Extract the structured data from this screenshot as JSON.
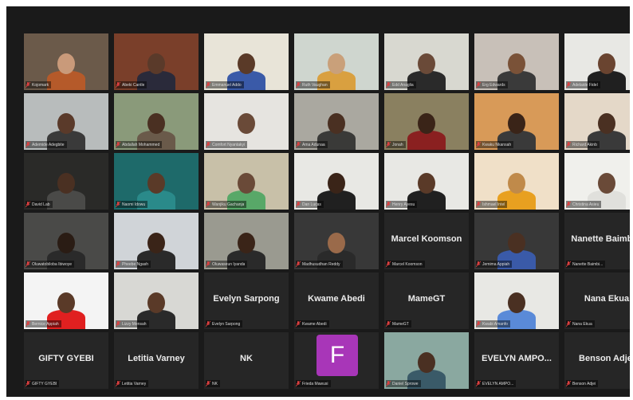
{
  "window": {
    "background": "#1a1a1a",
    "active_speaker_color": "#c7d94a"
  },
  "tiles": [
    {
      "kind": "video",
      "label": "Kojomark",
      "bg": "#6b5a4a",
      "skin": "#c99a7a",
      "shirt": "#b55a2a"
    },
    {
      "kind": "video",
      "label": "Abeki Cantle",
      "bg": "#7a3f2a",
      "skin": "#5a3a2a",
      "shirt": "#2a2a3a"
    },
    {
      "kind": "video",
      "label": "Emmanuel Addo",
      "bg": "#e8e4d8",
      "skin": "#5a3a28",
      "shirt": "#3a5aa8",
      "active": true
    },
    {
      "kind": "video",
      "label": "Ruth Vaughan",
      "bg": "#cfd6cf",
      "skin": "#c9a07a",
      "shirt": "#d9a040"
    },
    {
      "kind": "video",
      "label": "Edd Anaglia",
      "bg": "#d8d8d0",
      "skin": "#6a4a38",
      "shirt": "#2a2a2a"
    },
    {
      "kind": "video",
      "label": "Erg Edwards",
      "bg": "#c8c0b8",
      "skin": "#7a5238",
      "shirt": "#3a3a3a"
    },
    {
      "kind": "video",
      "label": "Adelaide Fidel",
      "bg": "#e8e8e4",
      "skin": "#6a4430",
      "shirt": "#202020"
    },
    {
      "kind": "video",
      "label": "Ademide Adegbite",
      "bg": "#b8bcbc",
      "skin": "#5a3a2a",
      "shirt": "#3a3a3a"
    },
    {
      "kind": "video",
      "label": "Abdallah Mohammed",
      "bg": "#8a9a7a",
      "skin": "#4a3022",
      "shirt": "#6a5a4a"
    },
    {
      "kind": "video",
      "label": "Comfort Nyantakyi",
      "bg": "#e6e4e0",
      "skin": "#6a4a38",
      "shirt": "#e6e4e0"
    },
    {
      "kind": "video",
      "label": "Ama Adunaa",
      "bg": "#aaa8a0",
      "skin": "#4a3022",
      "shirt": "#3a3a38"
    },
    {
      "kind": "video",
      "label": "Jonah",
      "bg": "#8a8060",
      "skin": "#3a2418",
      "shirt": "#8a2020"
    },
    {
      "kind": "video",
      "label": "Kwaku Nkansah",
      "bg": "#d89a58",
      "skin": "#3a2418",
      "shirt": "#3a3a3a"
    },
    {
      "kind": "video",
      "label": "Richard Akinb",
      "bg": "#e4d8c8",
      "skin": "#4a3022",
      "shirt": "#3a3a3a"
    },
    {
      "kind": "video",
      "label": "David Lab",
      "bg": "#2a2a28",
      "skin": "#4a3022",
      "shirt": "#4a4a48"
    },
    {
      "kind": "video",
      "label": "Naomi Idowu",
      "bg": "#1e6a6a",
      "skin": "#5a3a28",
      "shirt": "#2a8a8a"
    },
    {
      "kind": "video",
      "label": "Wanjiku Gachanja",
      "bg": "#c8c0a8",
      "skin": "#6a4a38",
      "shirt": "#58a868"
    },
    {
      "kind": "video",
      "label": "Dan Lucas",
      "bg": "#e8e8e4",
      "skin": "#3a2418",
      "shirt": "#202020"
    },
    {
      "kind": "video",
      "label": "Henry Ayesu",
      "bg": "#e8e8e4",
      "skin": "#5a3a28",
      "shirt": "#202020"
    },
    {
      "kind": "video",
      "label": "Ishmael Intel",
      "bg": "#f0e0c8",
      "skin": "#c08a4a",
      "shirt": "#e8a020"
    },
    {
      "kind": "video",
      "label": "Christina Asieu",
      "bg": "#f0f0ec",
      "skin": "#6a4a38",
      "shirt": "#e0e0dc"
    },
    {
      "kind": "video",
      "label": "Oluwatobiloba Ibiwoye",
      "bg": "#4a4a48",
      "skin": "#2a1c14",
      "shirt": "#2a2a2a"
    },
    {
      "kind": "video",
      "label": "Pheebe Ngash",
      "bg": "#d0d4d8",
      "skin": "#3a2418",
      "shirt": "#2a2a2a"
    },
    {
      "kind": "video",
      "label": "Oluwaseun Iyanda",
      "bg": "#9a9a90",
      "skin": "#3a2418",
      "shirt": "#2a2a2a"
    },
    {
      "kind": "video",
      "label": "Madhusudhan Reddy",
      "bg": "#383838",
      "skin": "#9a6a4a",
      "shirt": "#2a2a2a"
    },
    {
      "kind": "name",
      "label": "Marcel Koomson",
      "big": "Marcel Koomson"
    },
    {
      "kind": "video",
      "label": "Jemima Appiah",
      "bg": "#383838",
      "skin": "#4a3022",
      "shirt": "#3a5aa8"
    },
    {
      "kind": "name",
      "label": "Nanette Baimbi...",
      "big": "Nanette Baimbi..."
    },
    {
      "kind": "video",
      "label": "Bernice Appiah",
      "bg": "#f4f4f4",
      "skin": "#5a3a28",
      "shirt": "#e02020"
    },
    {
      "kind": "video",
      "label": "Lizzy Mensah",
      "bg": "#d8d8d4",
      "skin": "#5a3a28",
      "shirt": "#2a2a2a"
    },
    {
      "kind": "name",
      "label": "Evelyn Sarpong",
      "big": "Evelyn Sarpong"
    },
    {
      "kind": "name",
      "label": "Kwame Abedi",
      "big": "Kwame Abedi"
    },
    {
      "kind": "name",
      "label": "MameGT",
      "big": "MameGT"
    },
    {
      "kind": "video",
      "label": "Kwabi Amanfo",
      "bg": "#e8e8e4",
      "skin": "#4a3022",
      "shirt": "#5a8ad8"
    },
    {
      "kind": "name",
      "label": "Nana Ekua",
      "big": "Nana Ekua"
    },
    {
      "kind": "name",
      "label": "GIFTY GYEBI",
      "big": "GIFTY GYEBI"
    },
    {
      "kind": "name",
      "label": "Letitia Varney",
      "big": "Letitia Varney"
    },
    {
      "kind": "name",
      "label": "NK",
      "big": "NK"
    },
    {
      "kind": "avatar",
      "label": "Frieda Mawusi",
      "letter": "F",
      "color": "#a836b8"
    },
    {
      "kind": "video",
      "label": "Daniel Sprowe",
      "bg": "#8aa8a0",
      "skin": "#4a3022",
      "shirt": "#3a5a68"
    },
    {
      "kind": "name",
      "label": "EVELYN AMPO...",
      "big": "EVELYN AMPO..."
    },
    {
      "kind": "name",
      "label": "Benson Adjei",
      "big": "Benson Adjei"
    }
  ]
}
